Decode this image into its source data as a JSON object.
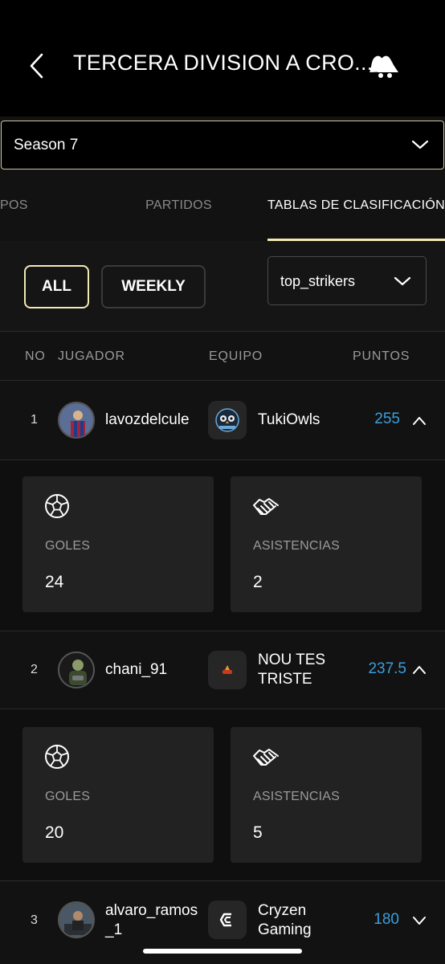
{
  "header": {
    "title": "TERCERA DIVISION A CRO...",
    "back_icon": "chevron-left-icon",
    "notify_icon": "bell-icon"
  },
  "season_select": {
    "value": "Season 7"
  },
  "tabs": [
    {
      "label": "IPOS",
      "active": false
    },
    {
      "label": "PARTIDOS",
      "active": false
    },
    {
      "label": "TABLAS DE CLASIFICACIÓN",
      "active": true
    }
  ],
  "filters": {
    "all_label": "ALL",
    "weekly_label": "WEEKLY",
    "stat_select": "top_strikers"
  },
  "table": {
    "headers": {
      "no": "NO",
      "player": "JUGADOR",
      "team": "EQUIPO",
      "points": "PUNTOS"
    },
    "rows": [
      {
        "no": "1",
        "player": "lavozdelcule",
        "team": "TukiOwls",
        "points": "255",
        "expanded": true,
        "stats": {
          "goals_label": "GOLES",
          "goals": "24",
          "assists_label": "ASISTENCIAS",
          "assists": "2"
        }
      },
      {
        "no": "2",
        "player": "chani_91",
        "team": "NOU TES TRISTE",
        "points": "237.5",
        "expanded": true,
        "stats": {
          "goals_label": "GOLES",
          "goals": "20",
          "assists_label": "ASISTENCIAS",
          "assists": "5"
        }
      },
      {
        "no": "3",
        "player": "alvaro_ramos_1",
        "team": "Cryzen Gaming",
        "points": "180",
        "expanded": false
      }
    ]
  },
  "colors": {
    "accent": "#f2e9b4",
    "points": "#3a9fdc",
    "background": "#121212"
  }
}
